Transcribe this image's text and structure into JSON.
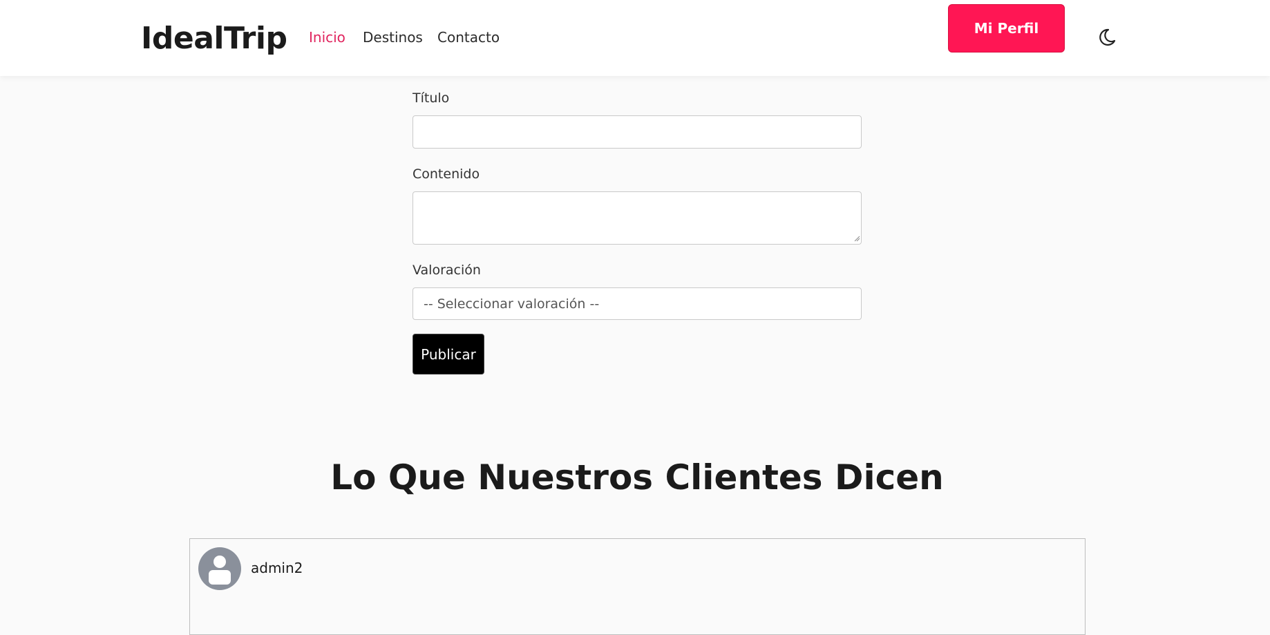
{
  "header": {
    "brand": "IdealTrip",
    "nav": [
      {
        "label": "Inicio",
        "active": true
      },
      {
        "label": "Destinos",
        "active": false
      },
      {
        "label": "Contacto",
        "active": false
      }
    ],
    "profile_button": "Mi Perfil",
    "theme_icon": "moon-icon",
    "accent_color": "#ff1654",
    "active_link_color": "#e0245e"
  },
  "form": {
    "titulo_label": "Título",
    "titulo_value": "",
    "contenido_label": "Contenido",
    "contenido_value": "",
    "valoracion_label": "Valoración",
    "valoracion_selected": "-- Seleccionar valoración --",
    "submit_label": "Publicar"
  },
  "testimonials": {
    "title": "Lo Que Nuestros Clientes Dicen",
    "reviews": [
      {
        "author": "admin2",
        "avatar_icon": "user-avatar-icon"
      }
    ]
  }
}
